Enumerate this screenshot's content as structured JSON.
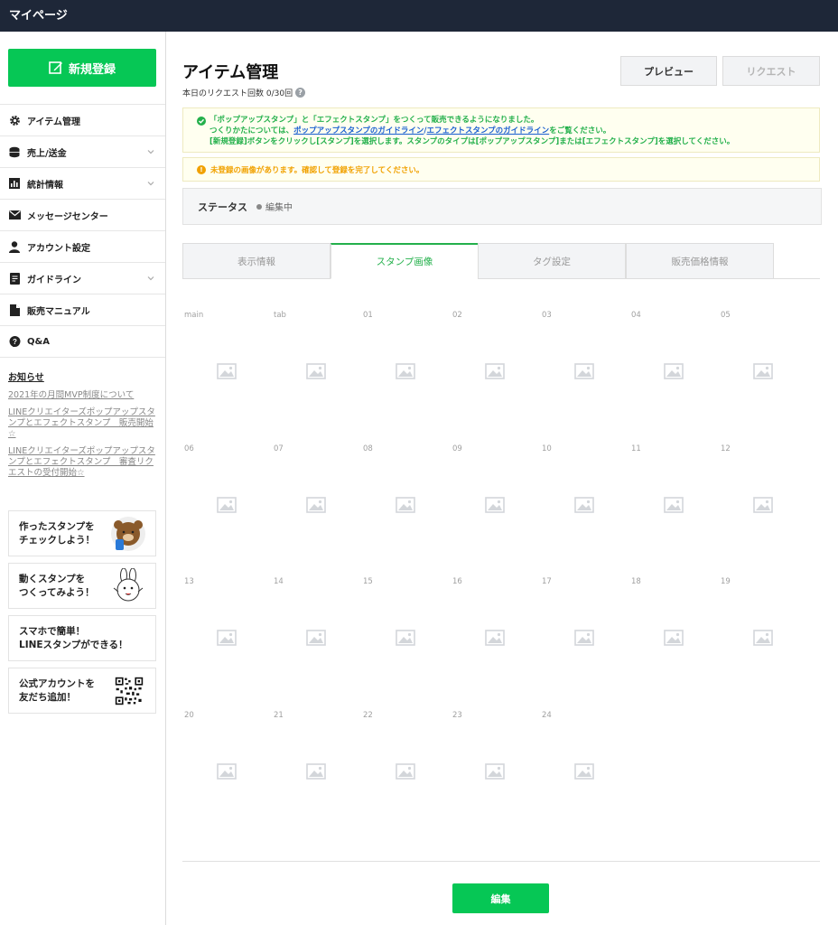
{
  "header": {
    "title": "マイページ"
  },
  "sidebar": {
    "signup_label": "新規登録",
    "items": [
      {
        "label": "アイテム管理",
        "icon": "gear-icon",
        "expandable": false
      },
      {
        "label": "売上/送金",
        "icon": "coins-icon",
        "expandable": true
      },
      {
        "label": "統計情報",
        "icon": "bar-chart-icon",
        "expandable": true
      },
      {
        "label": "メッセージセンター",
        "icon": "mail-icon",
        "expandable": false
      },
      {
        "label": "アカウント設定",
        "icon": "user-icon",
        "expandable": false
      },
      {
        "label": "ガイドライン",
        "icon": "document-icon",
        "expandable": true
      },
      {
        "label": "販売マニュアル",
        "icon": "file-icon",
        "expandable": false
      },
      {
        "label": "Q&A",
        "icon": "question-bubble-icon",
        "expandable": false
      }
    ],
    "news": {
      "title": "お知らせ",
      "links": [
        "2021年の月間MVP制度について",
        "LINEクリエイターズポップアップスタンプとエフェクトスタンプ　販売開始☆",
        "LINEクリエイターズポップアップスタンプとエフェクトスタンプ　審査リクエストの受付開始☆"
      ]
    },
    "promos": [
      {
        "text1": "作ったスタンプを",
        "text2": "チェックしよう！",
        "image": "brown-bear-icon"
      },
      {
        "text1": "動くスタンプを",
        "text2": "つくってみよう！",
        "image": "cony-rabbit-icon"
      },
      {
        "text1": "スマホで簡単！",
        "text2": "LINEスタンプができる！",
        "image": ""
      },
      {
        "text1": "公式アカウントを",
        "text2": "友だち追加！",
        "image": "qr-code-icon"
      }
    ]
  },
  "main": {
    "title": "アイテム管理",
    "request_count": "本日のリクエスト回数 0/30回",
    "preview_label": "プレビュー",
    "request_label": "リクエスト",
    "notice": {
      "line1": "「ポップアップスタンプ」と「エフェクトスタンプ」をつくって販売できるようになりました。",
      "line2_prefix": "つくりかたについては、",
      "link1": "ポップアップスタンプのガイドライン",
      "sep": "/",
      "link2": "エフェクトスタンプのガイドライン",
      "line2_suffix": "をご覧ください。",
      "line3": "[新規登録]ボタンをクリックし[スタンプ]を選択します。スタンプのタイプは[ポップアップスタンプ]または[エフェクトスタンプ]を選択してください。"
    },
    "warning": "未登録の画像があります。確認して登録を完了してください。",
    "status_label": "ステータス",
    "status_value": "編集中",
    "tabs": [
      "表示情報",
      "スタンプ画像",
      "タグ設定",
      "販売価格情報"
    ],
    "active_tab": 1,
    "stamp_slots": [
      "main",
      "tab",
      "01",
      "02",
      "03",
      "04",
      "05",
      "06",
      "07",
      "08",
      "09",
      "10",
      "11",
      "12",
      "13",
      "14",
      "15",
      "16",
      "17",
      "18",
      "19",
      "20",
      "21",
      "22",
      "23",
      "24"
    ],
    "edit_label": "編集"
  }
}
